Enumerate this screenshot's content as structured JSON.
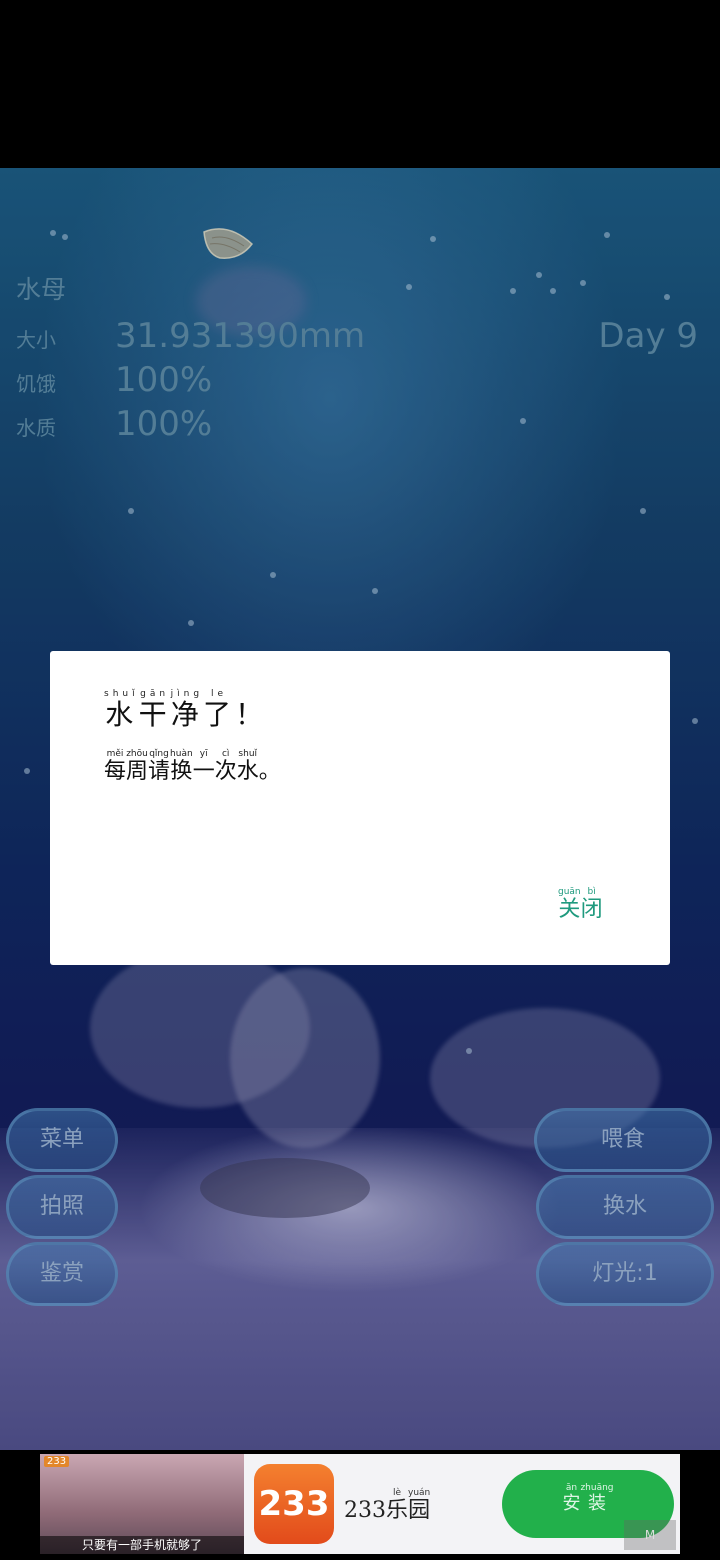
{
  "stats": {
    "title": "水母",
    "size_label": "大小",
    "size_value": "31.931390mm",
    "hunger_label": "饥饿",
    "hunger_value": "100%",
    "water_label": "水质",
    "water_value": "100%",
    "day": "Day 9"
  },
  "buttons": {
    "menu": "菜单",
    "photo": "拍照",
    "collection": "鉴赏",
    "feed": "喂食",
    "change_water": "换水",
    "light": "灯光:1"
  },
  "dialog": {
    "title_chars": [
      "水",
      "干",
      "净",
      "了",
      "！"
    ],
    "title_pinyin": [
      "shuǐ",
      "gān",
      "jìng",
      "le",
      ""
    ],
    "body_chars": [
      "每",
      "周",
      "请",
      "换",
      "一",
      "次",
      "水",
      "。"
    ],
    "body_pinyin": [
      "měi",
      "zhōu",
      "qǐng",
      "huàn",
      "yī",
      "cì",
      "shuǐ",
      ""
    ],
    "close_chars": [
      "关",
      "闭"
    ],
    "close_pinyin": [
      "guān",
      "bì"
    ]
  },
  "ad": {
    "badge": "233",
    "thumb_caption": "只要有一部手机就够了",
    "logo_text": "233",
    "name_prefix": "233",
    "name_chars": [
      "乐",
      "园"
    ],
    "name_pinyin": [
      "lè",
      "yuán"
    ],
    "install_chars": [
      "安",
      "装"
    ],
    "install_pinyin": [
      "ān",
      "zhuāng"
    ],
    "mark": "M"
  },
  "colors": {
    "stat_text": "#5f8fa9",
    "close_text": "#1f9a7e",
    "install_bg": "#22b04b",
    "logo_bg": "#f4802f"
  }
}
